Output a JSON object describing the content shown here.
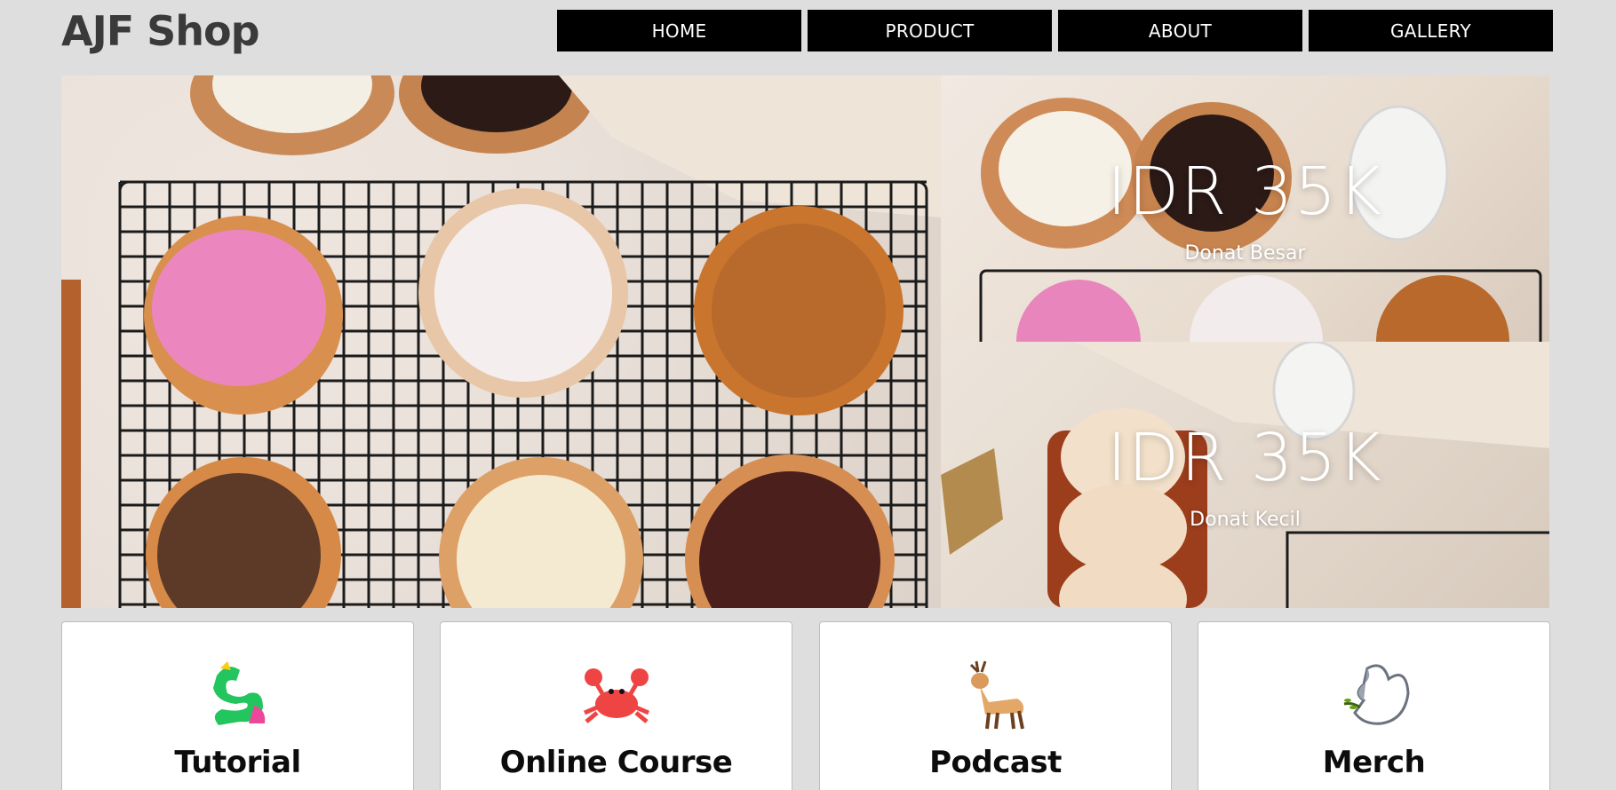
{
  "brand": {
    "logo": "AJF Shop"
  },
  "nav": [
    {
      "label": "HOME"
    },
    {
      "label": "PRODUCT"
    },
    {
      "label": "ABOUT"
    },
    {
      "label": "GALLERY"
    }
  ],
  "promos": [
    {
      "price": "IDR 35K",
      "name": "Donat Besar"
    },
    {
      "price": "IDR 35K",
      "name": "Donat Kecil"
    }
  ],
  "cards": [
    {
      "label": "Tutorial",
      "icon": "dragon-icon"
    },
    {
      "label": "Online Course",
      "icon": "crab-icon"
    },
    {
      "label": "Podcast",
      "icon": "deer-icon"
    },
    {
      "label": "Merch",
      "icon": "dove-icon"
    }
  ]
}
